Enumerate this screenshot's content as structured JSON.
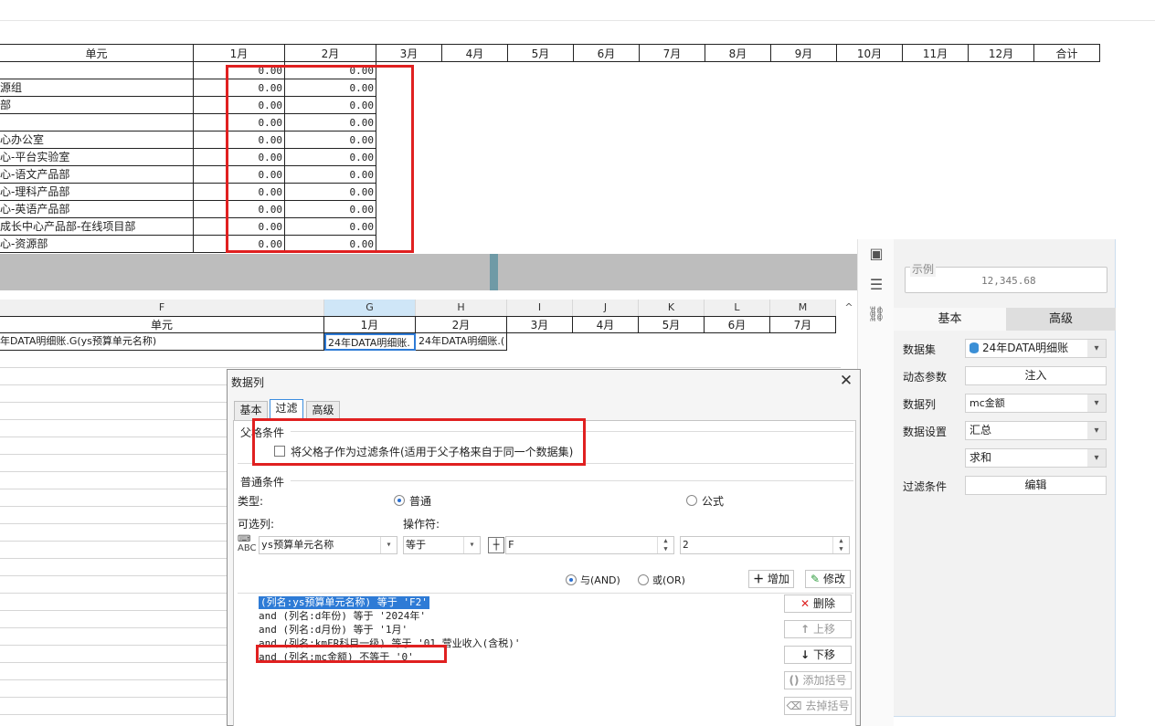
{
  "report": {
    "headers": [
      "单元",
      "1月",
      "2月",
      "3月",
      "4月",
      "5月",
      "6月",
      "7月",
      "8月",
      "9月",
      "10月",
      "11月",
      "12月",
      "合计"
    ],
    "rows": [
      {
        "label": "",
        "m1": "0.00",
        "m2": "0.00"
      },
      {
        "label": "源组",
        "m1": "0.00",
        "m2": "0.00"
      },
      {
        "label": "部",
        "m1": "0.00",
        "m2": "0.00"
      },
      {
        "label": "",
        "m1": "0.00",
        "m2": "0.00"
      },
      {
        "label": "心办公室",
        "m1": "0.00",
        "m2": "0.00"
      },
      {
        "label": "心-平台实验室",
        "m1": "0.00",
        "m2": "0.00"
      },
      {
        "label": "心-语文产品部",
        "m1": "0.00",
        "m2": "0.00"
      },
      {
        "label": "心-理科产品部",
        "m1": "0.00",
        "m2": "0.00"
      },
      {
        "label": "心-英语产品部",
        "m1": "0.00",
        "m2": "0.00"
      },
      {
        "label": "成长中心产品部-在线项目部",
        "m1": "0.00",
        "m2": "0.00"
      },
      {
        "label": "心-资源部",
        "m1": "0.00",
        "m2": "0.00"
      }
    ]
  },
  "sheet": {
    "col_letters": [
      "F",
      "G",
      "H",
      "I",
      "J",
      "K",
      "L",
      "M"
    ],
    "header_row": [
      "单元",
      "1月",
      "2月",
      "3月",
      "4月",
      "5月",
      "6月",
      "7月"
    ],
    "data_row": {
      "f": "年DATA明细账.G(ys预算单元名称)",
      "g": "24年DATA明细账.",
      "h": "24年DATA明细账.("
    },
    "scroll_up": "^"
  },
  "properties": {
    "example_legend": "示例",
    "example_value": "12,345.68",
    "tab_basic": "基本",
    "tab_advanced": "高级",
    "dataset_label": "数据集",
    "dataset_value": "24年DATA明细账",
    "dynamic_param_label": "动态参数",
    "dynamic_param_btn": "注入",
    "data_column_label": "数据列",
    "data_column_value": "mc金额",
    "data_setting_label": "数据设置",
    "data_setting_value": "汇总",
    "aggregate_value": "求和",
    "filter_label": "过滤条件",
    "filter_btn": "编辑"
  },
  "dialog": {
    "title": "数据列",
    "close": "✕",
    "tabs": [
      "基本",
      "过滤",
      "高级"
    ],
    "parent_group": "父格条件",
    "parent_checkbox_label": "将父格子作为过滤条件(适用于父子格来自于同一个数据集)",
    "normal_group": "普通条件",
    "type_label": "类型:",
    "type_normal": "普通",
    "type_formula": "公式",
    "column_label": "可选列:",
    "operator_label": "操作符:",
    "column_value": "ys预算单元名称",
    "operator_value": "等于",
    "value1": "F",
    "value2": "2",
    "and_label": "与(AND)",
    "or_label": "或(OR)",
    "add_btn": "增加",
    "modify_btn": "修改",
    "conditions": [
      "(列名:ys预算单元名称) 等于 'F2'",
      "and (列名:d年份) 等于 '2024年'",
      "and (列名:d月份) 等于 '1月'",
      "and (列名:kmFR科目一级) 等于 '01.营业收入(含税)'",
      "and (列名:mc金额) 不等于 '0'"
    ],
    "delete_btn": "删除",
    "move_up_btn": "上移",
    "move_down_btn": "下移",
    "add_bracket_btn": "添加括号",
    "remove_bracket_btn": "去掉括号"
  },
  "colors": {
    "highlight": "#e02020",
    "selection": "#2e7bd6",
    "grey_band": "#bdbdbd"
  }
}
